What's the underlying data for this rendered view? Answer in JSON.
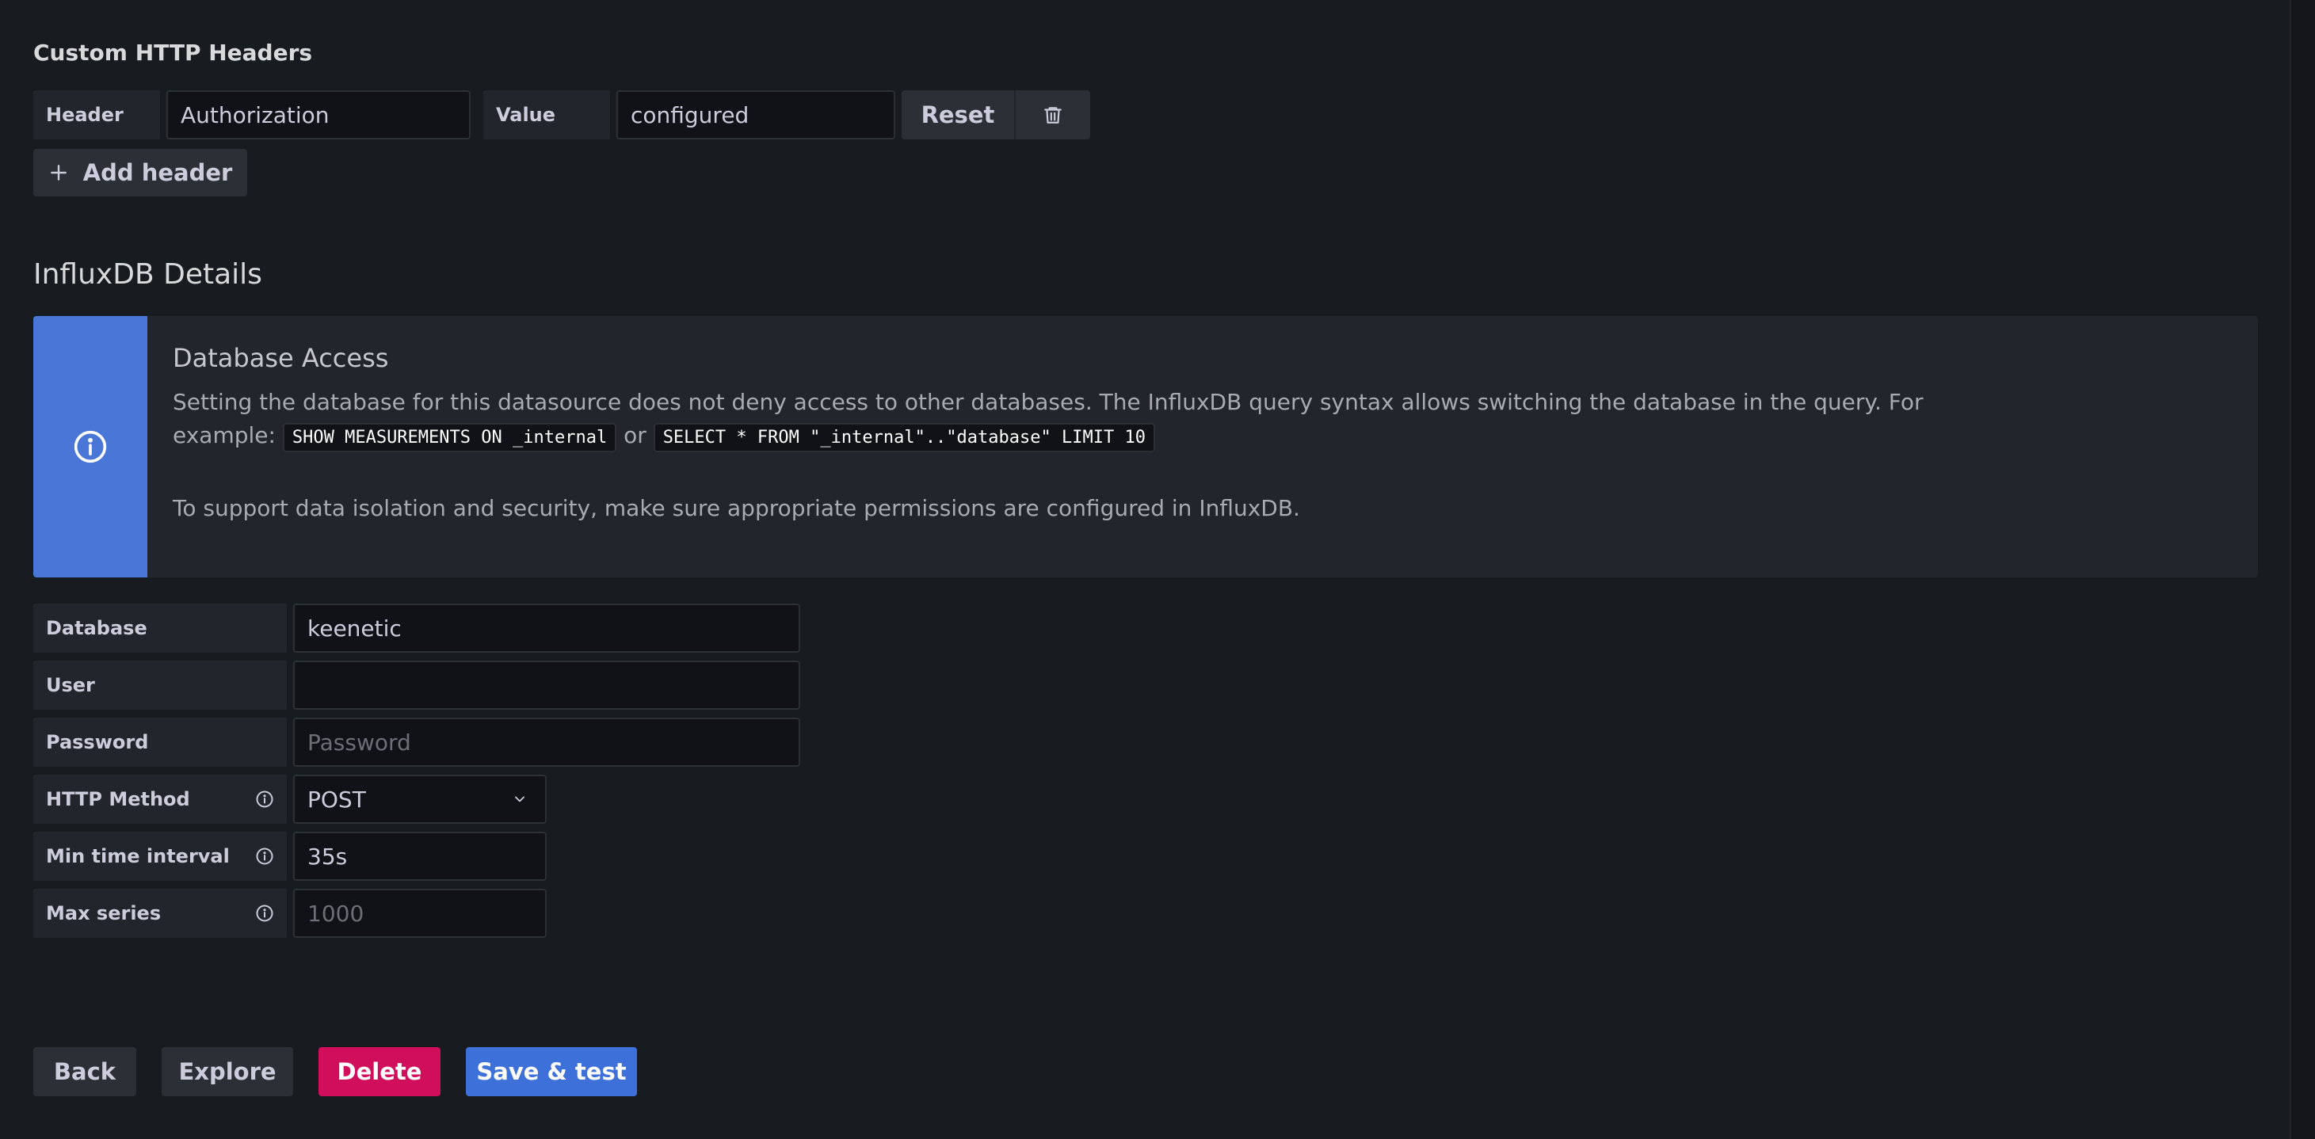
{
  "custom_headers": {
    "section_title": "Custom HTTP Headers",
    "header_label": "Header",
    "header_value": "Authorization",
    "value_label": "Value",
    "value_value": "configured",
    "reset_label": "Reset",
    "add_header_label": "Add header"
  },
  "influx": {
    "section_title": "InfluxDB Details",
    "alert": {
      "title": "Database Access",
      "line1": "Setting the database for this datasource does not deny access to other databases. The InfluxDB query syntax allows switching the database in the query. For",
      "line2_prefix": "example:",
      "code1": "SHOW MEASUREMENTS ON _internal",
      "or_text": "or",
      "code2": "SELECT * FROM \"_internal\"..\"database\" LIMIT 10",
      "line3": "To support data isolation and security, make sure appropriate permissions are configured in InfluxDB."
    },
    "fields": {
      "database": {
        "label": "Database",
        "value": "keenetic"
      },
      "user": {
        "label": "User",
        "value": ""
      },
      "password": {
        "label": "Password",
        "placeholder": "Password"
      },
      "http_method": {
        "label": "HTTP Method",
        "value": "POST"
      },
      "min_time_interval": {
        "label": "Min time interval",
        "value": "35s"
      },
      "max_series": {
        "label": "Max series",
        "placeholder": "1000"
      }
    }
  },
  "actions": {
    "back": "Back",
    "explore": "Explore",
    "delete": "Delete",
    "save_test": "Save & test"
  },
  "icons": {
    "trash": "trash-icon",
    "plus": "plus-icon",
    "alert_info": "info-circle-icon",
    "field_info": "info-circle-icon",
    "chevron": "chevron-down-icon"
  },
  "colors": {
    "background": "#181b1f",
    "panel": "#22252b",
    "primary": "#3d71d9",
    "destructive": "#d10e5c",
    "alert_accent": "#4a76d8"
  }
}
